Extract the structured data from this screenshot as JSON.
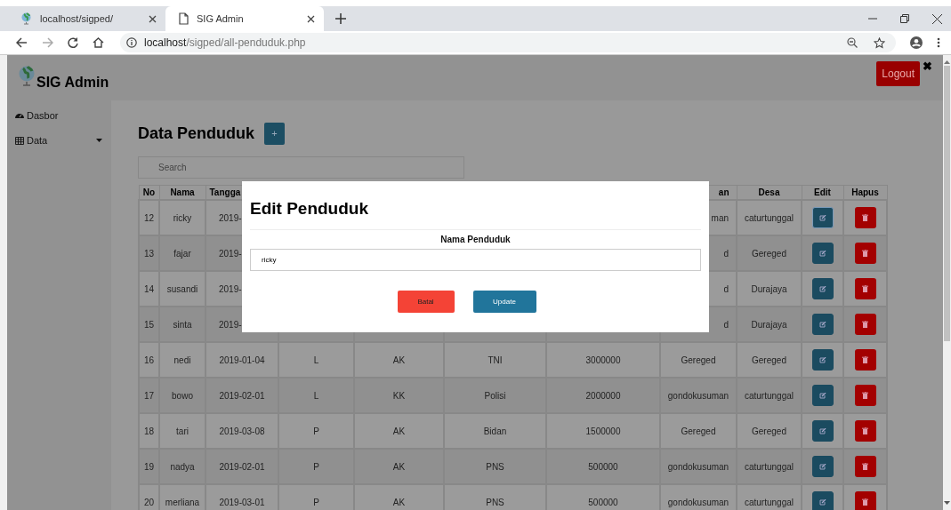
{
  "browser": {
    "tabs": [
      {
        "title": "localhost/sigped/",
        "selected": false
      },
      {
        "title": "SIG Admin",
        "selected": true
      }
    ],
    "url_host": "localhost",
    "url_path": "/sigped/all-penduduk.php"
  },
  "header": {
    "brand": "SIG Admin",
    "logout": "Logout",
    "close": "✖"
  },
  "sidebar": {
    "items": [
      {
        "label": "Dasbor",
        "kind": "link"
      },
      {
        "label": "Data",
        "kind": "dropdown"
      }
    ]
  },
  "page": {
    "title": "Data Penduduk",
    "add_button": "+",
    "search": {
      "placeholder": "Search"
    }
  },
  "table": {
    "columns": [
      {
        "label": "No"
      },
      {
        "label": "Nama"
      },
      {
        "label": "Tangga"
      },
      {},
      {},
      {},
      {},
      {
        "label": "an"
      },
      {
        "label": "Desa"
      },
      {
        "label": "Edit"
      },
      {
        "label": "Hapus"
      }
    ],
    "rows": [
      {
        "no": "12",
        "nama": "ricky",
        "tanggal": "2019-",
        "kecamatan": "man",
        "desa": "caturtunggal",
        "edit_focused": true
      },
      {
        "no": "13",
        "nama": "fajar",
        "tanggal": "2019-",
        "kecamatan": "d",
        "desa": "Gereged",
        "edit_focused": false
      },
      {
        "no": "14",
        "nama": "susandi",
        "tanggal": "2019-",
        "kecamatan": "d",
        "desa": "Durajaya",
        "edit_focused": false
      },
      {
        "no": "15",
        "nama": "sinta",
        "tanggal": "2019-",
        "kecamatan": "d",
        "desa": "Durajaya",
        "edit_focused": false
      },
      {
        "no": "16",
        "nama": "nedi",
        "tanggal": "2019-01-04",
        "jk": "L",
        "status": "AK",
        "pekerjaan": "TNI",
        "penghasilan": "3000000",
        "kecamatan": "Gereged",
        "desa": "Gereged",
        "edit_focused": false
      },
      {
        "no": "17",
        "nama": "bowo",
        "tanggal": "2019-02-01",
        "jk": "L",
        "status": "KK",
        "pekerjaan": "Polisi",
        "penghasilan": "2000000",
        "kecamatan": "gondokusuman",
        "desa": "caturtunggal",
        "edit_focused": false
      },
      {
        "no": "18",
        "nama": "tari",
        "tanggal": "2019-03-08",
        "jk": "P",
        "status": "AK",
        "pekerjaan": "Bidan",
        "penghasilan": "1500000",
        "kecamatan": "Gereged",
        "desa": "Gereged",
        "edit_focused": false
      },
      {
        "no": "19",
        "nama": "nadya",
        "tanggal": "2019-02-01",
        "jk": "P",
        "status": "AK",
        "pekerjaan": "PNS",
        "penghasilan": "500000",
        "kecamatan": "gondokusuman",
        "desa": "caturtunggal",
        "edit_focused": false
      },
      {
        "no": "20",
        "nama": "merliana",
        "tanggal": "2019-03-01",
        "jk": "P",
        "status": "AK",
        "pekerjaan": "PNS",
        "penghasilan": "500000",
        "kecamatan": "gondokusuman",
        "desa": "caturtunggal",
        "edit_focused": false
      }
    ]
  },
  "modal": {
    "title": "Edit Penduduk",
    "field_label": "Nama Penduduk",
    "field_value": "ricky",
    "cancel": "Batal",
    "submit": "Update"
  }
}
